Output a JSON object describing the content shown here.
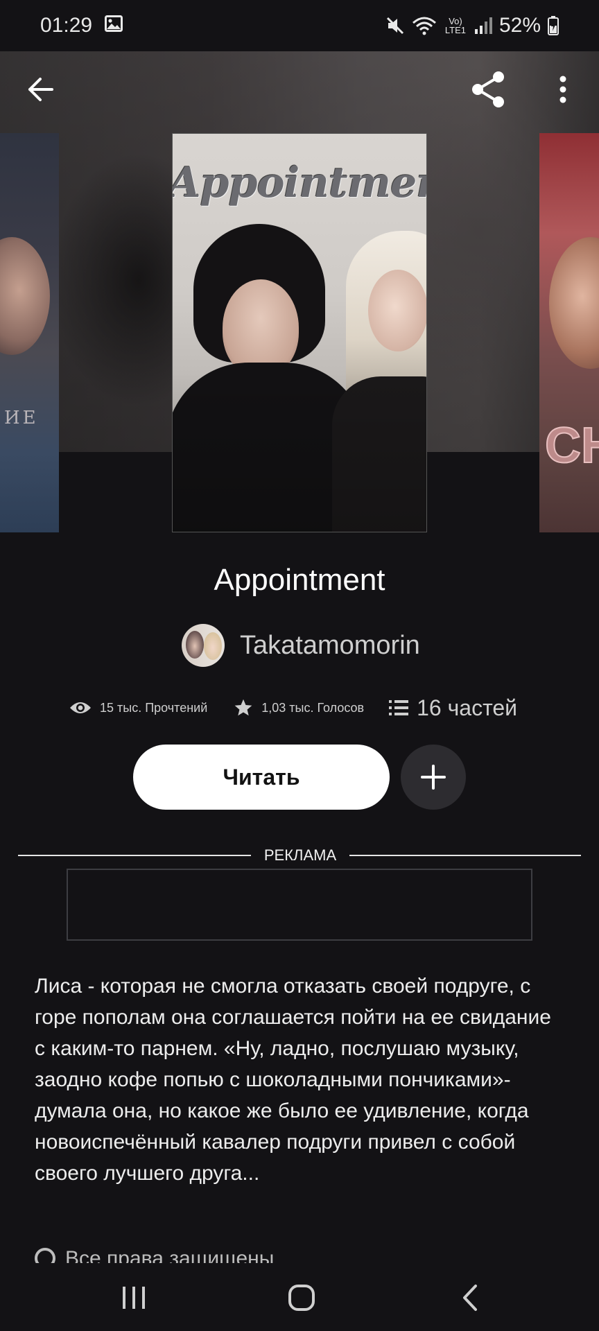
{
  "status_bar": {
    "time": "01:29",
    "battery": "52%",
    "network": "Vo) LTE1",
    "icons": [
      "gallery-icon",
      "mute-icon",
      "wifi-icon",
      "signal-icon",
      "battery-charging-icon"
    ]
  },
  "toolbar": {
    "back_icon": "arrow-left-icon",
    "share_icon": "share-icon",
    "more_icon": "more-vertical-icon"
  },
  "carousel": {
    "main_cover_title": "Appointment",
    "left_cover_text": "ИЕ",
    "right_cover_text": "CH"
  },
  "story": {
    "title": "Appointment",
    "author": "Takatamomorin",
    "reads": "15 тыс. Прочтений",
    "votes": "1,03 тыс. Голосов",
    "parts": "16 частей",
    "description": "Лиса - которая не смогла отказать своей подруге, с горе пополам она соглашается пойти на ее свидание с каким-то парнем. «Ну, ладно, послушаю музыку, заодно кофе попью с шоколадными пончиками»-думала она, но какое же было ее удивление, когда новоиспечённый кавалер подруги привел с собой своего лучшего друга...",
    "rights": "Все права защищены"
  },
  "actions": {
    "read_label": "Читать",
    "add_icon": "plus-icon"
  },
  "ad": {
    "label": "РЕКЛАМА"
  },
  "nav_bar": {
    "recent_icon": "recent-apps-icon",
    "home_icon": "home-icon",
    "back_icon": "nav-back-icon"
  },
  "colors": {
    "background": "#131215",
    "button_primary": "#ffffff",
    "button_secondary": "#2d2c30",
    "text_secondary": "#cfcfcf"
  }
}
